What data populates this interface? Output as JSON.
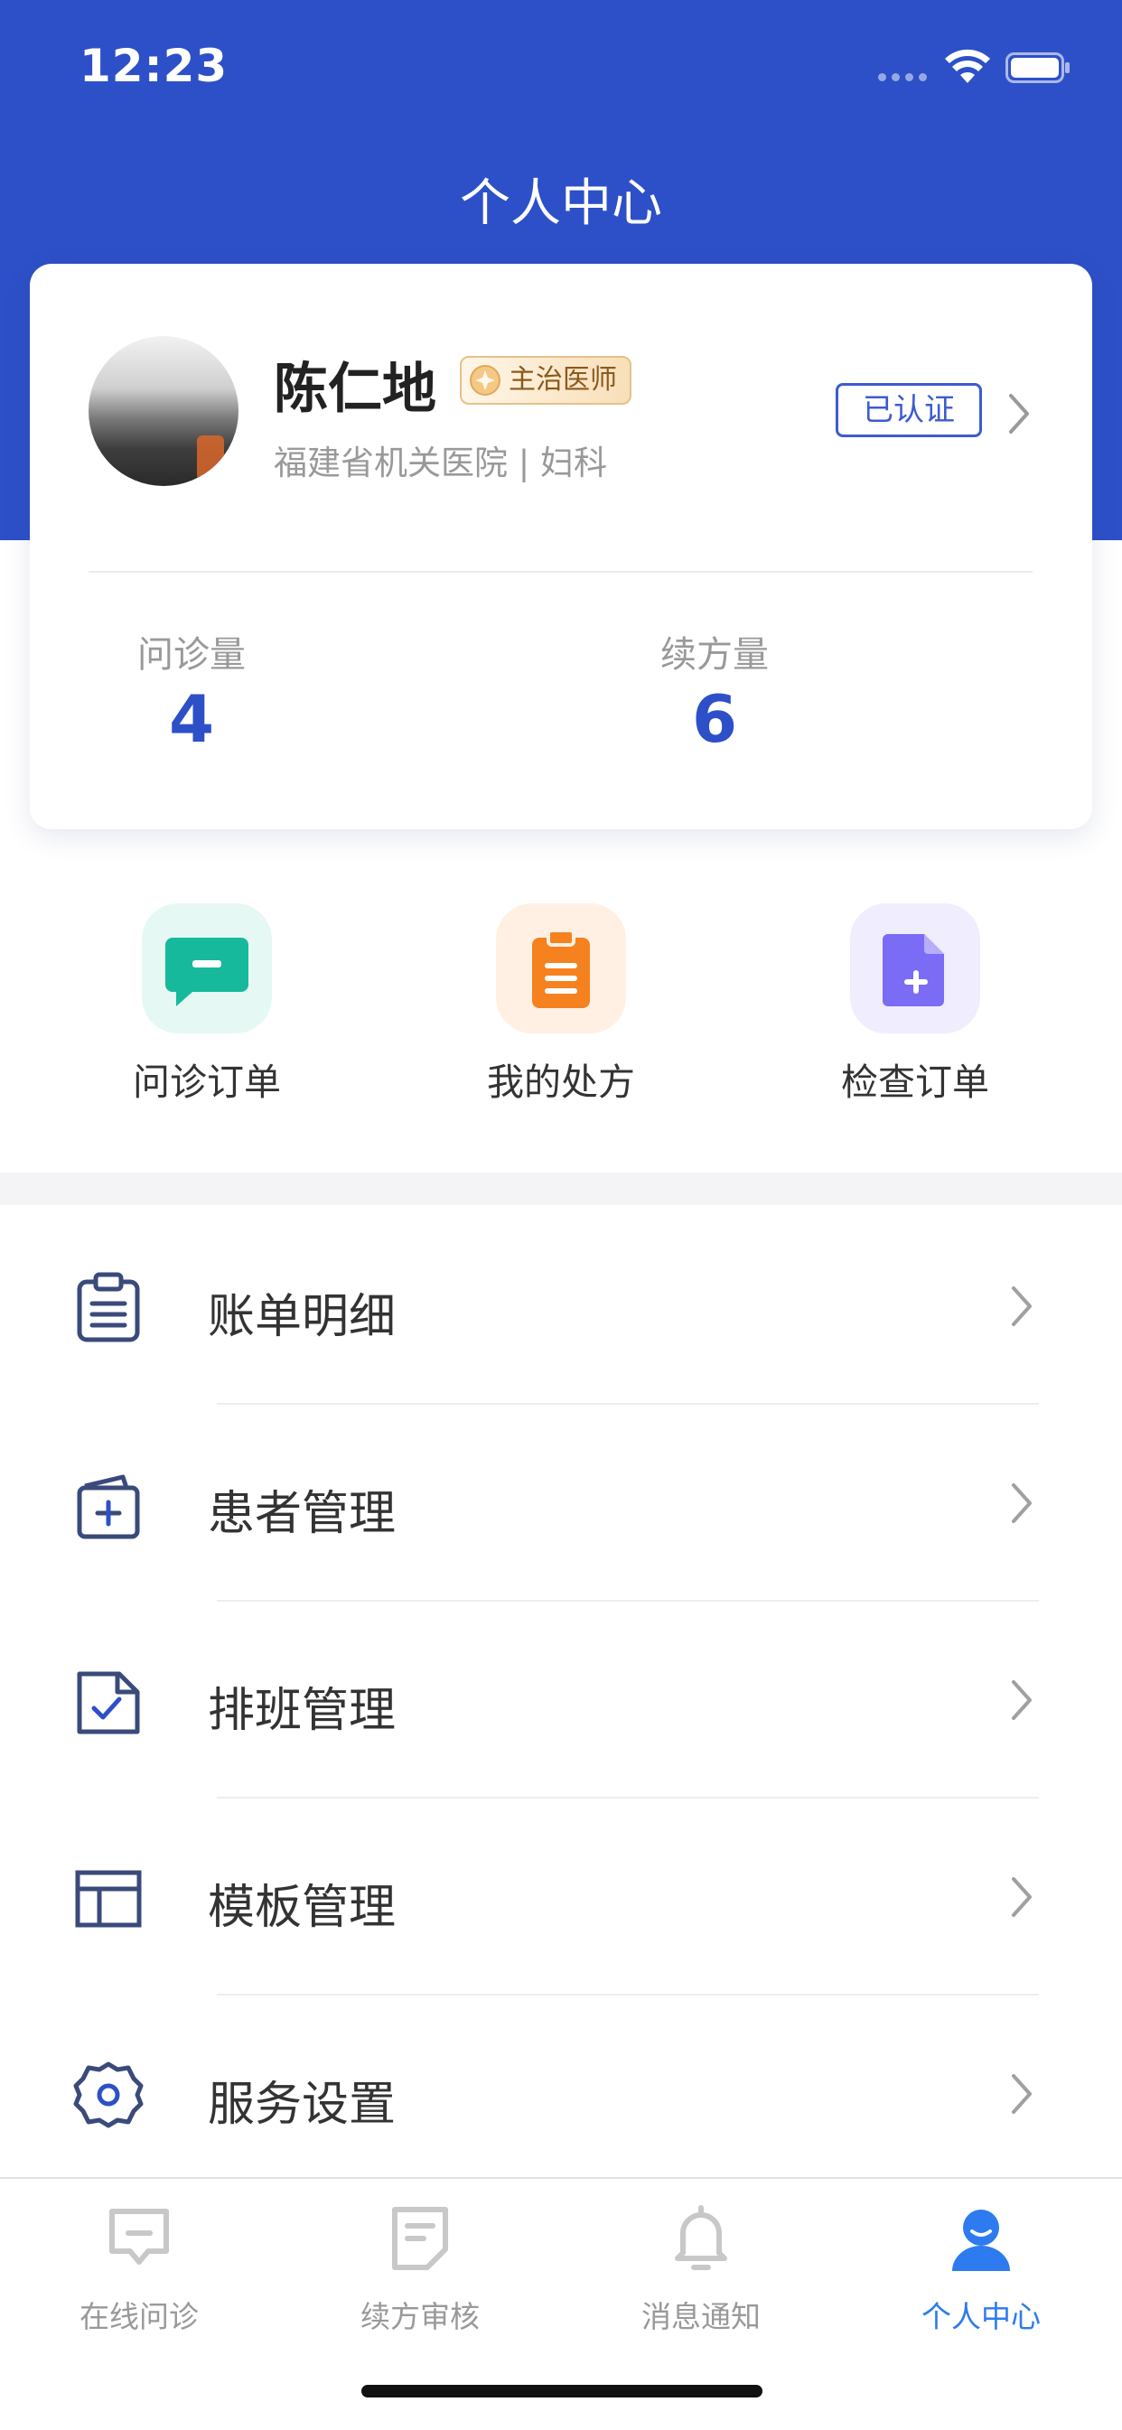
{
  "status_bar": {
    "time": "12:23"
  },
  "header": {
    "title": "个人中心"
  },
  "profile": {
    "name": "陈仁地",
    "title_badge": "主治医师",
    "hospital": "福建省机关医院 | 妇科",
    "verified_label": "已认证",
    "stats": [
      {
        "label": "问诊量",
        "value": "4"
      },
      {
        "label": "续方量",
        "value": "6"
      }
    ]
  },
  "shortcuts": [
    {
      "label": "问诊订单",
      "icon": "chat-bubble-icon",
      "color": "#17b99c",
      "bg": "#e6f8f4"
    },
    {
      "label": "我的处方",
      "icon": "clipboard-icon",
      "color": "#f5821f",
      "bg": "#fff0e3"
    },
    {
      "label": "检查订单",
      "icon": "document-add-icon",
      "color": "#7b6cf6",
      "bg": "#efedfe"
    }
  ],
  "menu": [
    {
      "label": "账单明细",
      "icon": "bill-clipboard-icon"
    },
    {
      "label": "患者管理",
      "icon": "patient-folder-icon"
    },
    {
      "label": "排班管理",
      "icon": "schedule-check-icon"
    },
    {
      "label": "模板管理",
      "icon": "template-layout-icon"
    },
    {
      "label": "服务设置",
      "icon": "gear-icon"
    }
  ],
  "tabs": [
    {
      "label": "在线问诊",
      "icon": "consult-icon",
      "active": false
    },
    {
      "label": "续方审核",
      "icon": "review-icon",
      "active": false
    },
    {
      "label": "消息通知",
      "icon": "bell-icon",
      "active": false
    },
    {
      "label": "个人中心",
      "icon": "user-icon",
      "active": true
    }
  ],
  "colors": {
    "primary": "#2d50c8",
    "tab_active": "#2d7bef",
    "tab_inactive": "#c8c8c8",
    "menu_icon": "#3a4a7a"
  }
}
